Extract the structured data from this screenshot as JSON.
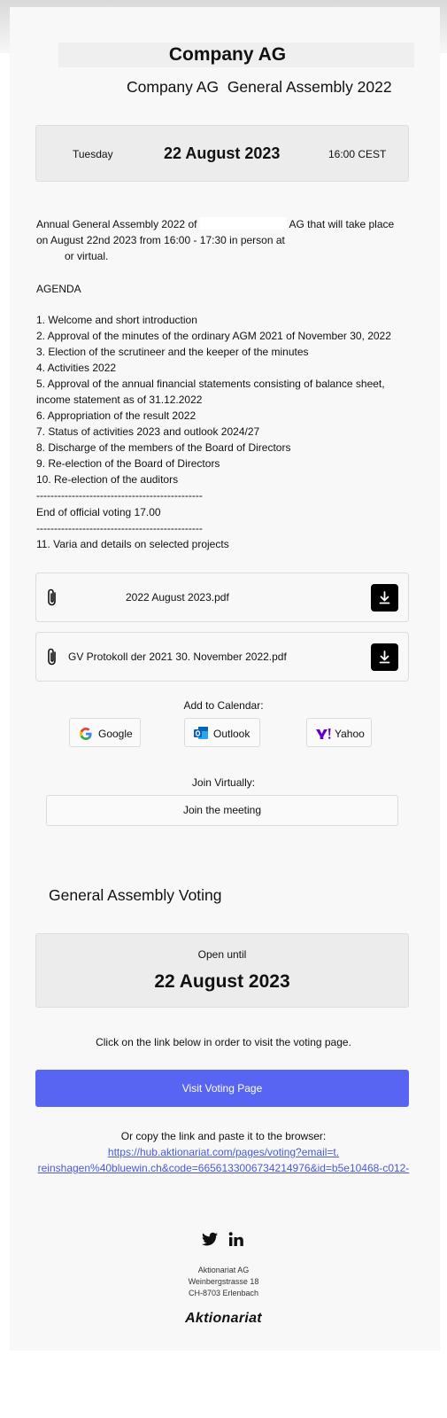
{
  "header": {
    "company": "Company AG",
    "subtitle_company": "Company AG",
    "subtitle_event": "General Assembly 2022"
  },
  "event_date": {
    "day": "Tuesday",
    "date": "22 August 2023",
    "time": "16:00 CEST"
  },
  "intro": {
    "line1_a": "Annual General Assembly 2022 of",
    "line1_b": "AG that will take place",
    "line2": "on August 22nd 2023 from 16:00 - 17:30 in person at",
    "line3": "or virtual."
  },
  "agenda": {
    "heading": "AGENDA",
    "items": [
      "1. Welcome and short introduction",
      "2. Approval of the minutes of the ordinary AGM 2021 of November 30, 2022",
      "3. Election of the scrutineer and the keeper of the minutes",
      "4. Activities 2022",
      "5. Approval of the annual financial statements consisting of balance sheet,",
      "income statement as of 31.12.2022",
      "6. Appropriation of the result 2022",
      "7. Status of activities 2023 and outlook 2024/27",
      "8. Discharge of the members of the Board of Directors",
      "9. Re-election of the Board of Directors",
      "10. Re-election of the auditors"
    ],
    "separator": "-----------------------------------------------",
    "voting_end": "End of official voting 17.00",
    "separator2": "-----------------------------------------------",
    "varia": "11. Varia and details on selected projects"
  },
  "attachments": [
    {
      "filename": "2022 August 2023.pdf"
    },
    {
      "filename": "GV Protokoll der 2021 30. November 2022.pdf"
    }
  ],
  "calendar": {
    "label": "Add to Calendar:",
    "google": "Google",
    "outlook": "Outlook",
    "yahoo": "Yahoo"
  },
  "virtual": {
    "label": "Join Virtually:",
    "button": "Join the meeting"
  },
  "voting": {
    "title": "General Assembly Voting",
    "open_label": "Open until",
    "open_date": "22 August 2023",
    "instruction": "Click on the link below in order to visit the voting page.",
    "button": "Visit Voting Page",
    "copy_text": "Or copy the link and paste it to the browser:",
    "link_line1": "https://hub.aktionariat.com/pages/voting?email=t.",
    "link_line2": "reinshagen%40bluewin.ch&code=6656133006734214976&id=b5e10468-c012-"
  },
  "footer": {
    "name": "Aktionariat AG",
    "street": "Weinbergstrasse 18",
    "city": "CH-8703 Erlenbach",
    "brand": "Aktionariat"
  },
  "colors": {
    "accent": "#5865f2",
    "link": "#4a5ad8",
    "download_bg": "#000000"
  }
}
